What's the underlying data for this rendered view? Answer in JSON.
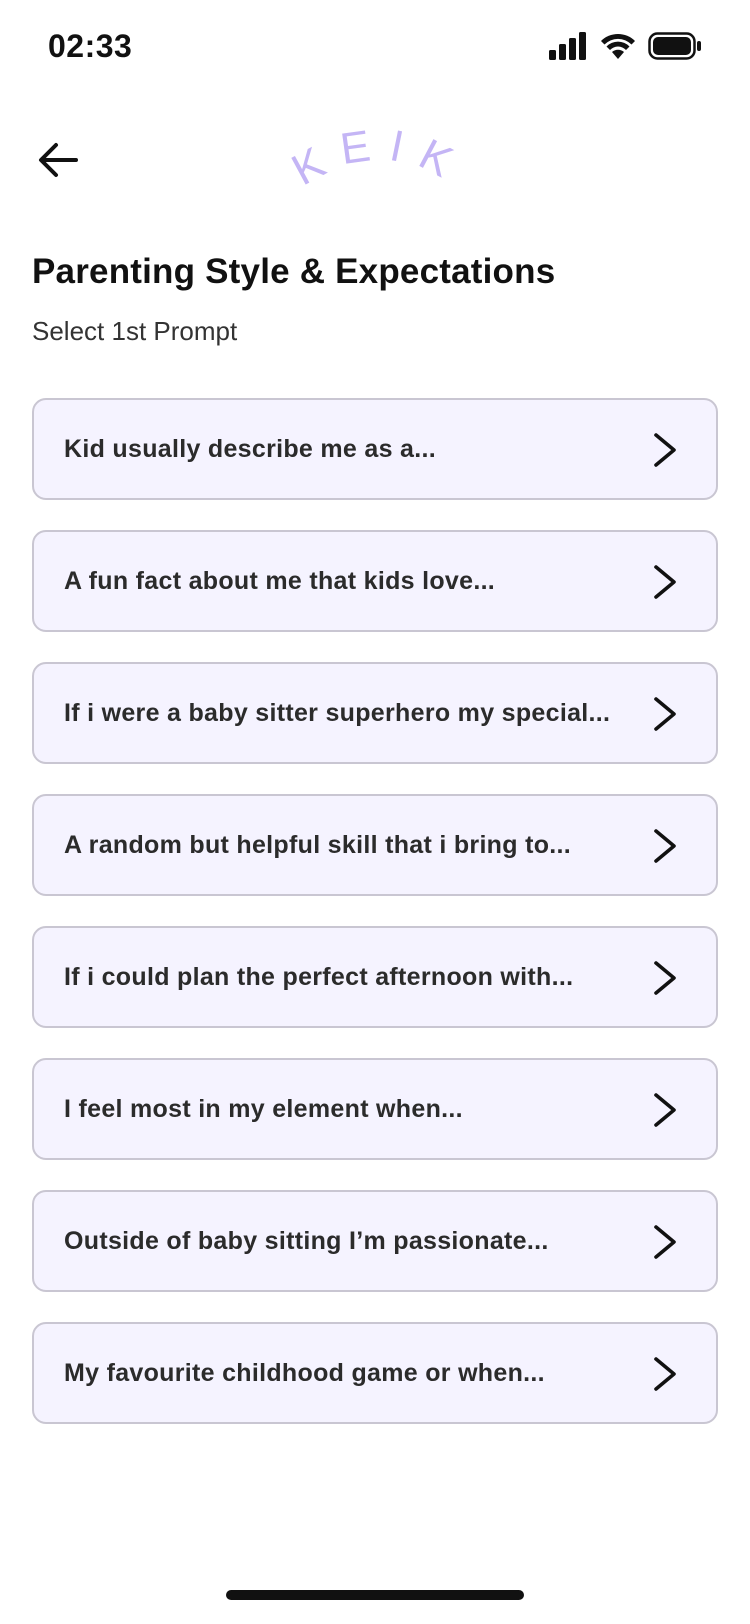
{
  "status": {
    "time": "02:33",
    "icons": [
      "cellular-signal-icon",
      "wifi-icon",
      "battery-icon"
    ]
  },
  "header": {
    "back_icon": "arrow-left-icon",
    "logo_text": "KEIKI",
    "logo_color": "#c4b5f5"
  },
  "page": {
    "title": "Parenting Style & Expectations",
    "subtitle": "Select 1st Prompt"
  },
  "prompts": [
    {
      "label": "Kid usually describe me as a..."
    },
    {
      "label": "A fun fact about me that kids love..."
    },
    {
      "label": "If i were a baby sitter superhero my special..."
    },
    {
      "label": "A random but helpful skill that i bring to..."
    },
    {
      "label": "If i could plan the perfect afternoon with..."
    },
    {
      "label": "I feel most in my element when..."
    },
    {
      "label": "Outside of baby sitting I’m passionate..."
    },
    {
      "label": "My favourite childhood game or when..."
    }
  ],
  "colors": {
    "card_bg": "#f5f3ff",
    "card_border": "#c9c6d2",
    "accent": "#c4b5f5"
  }
}
